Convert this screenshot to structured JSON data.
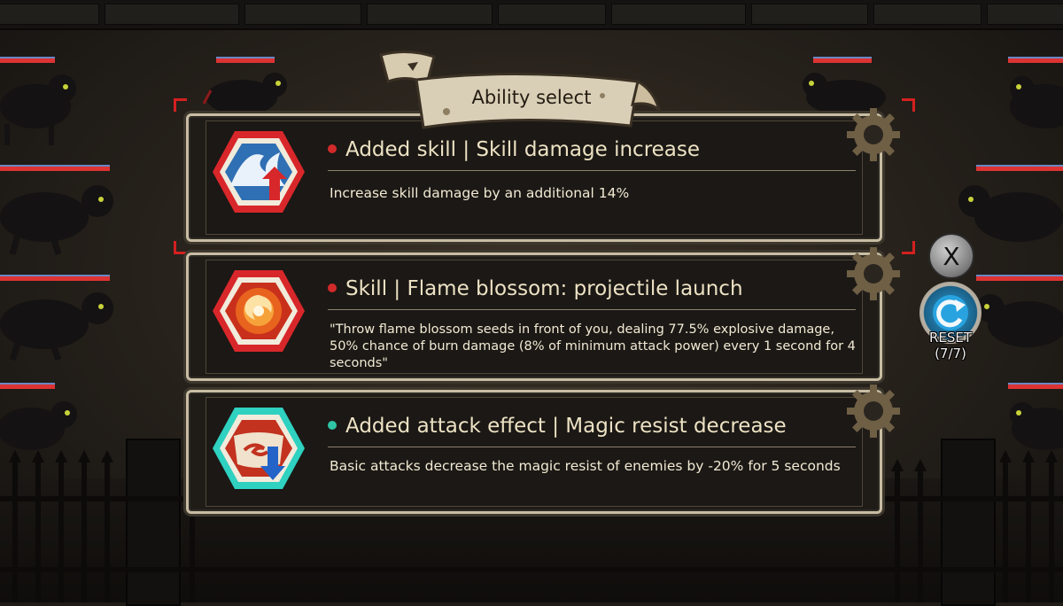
{
  "header": {
    "title": "Ability select"
  },
  "cards": [
    {
      "title": "Added skill | Skill damage increase",
      "description": "Increase skill damage by an additional 14%",
      "dot_color": "#d12a2a",
      "icon": "skill-damage-increase-icon",
      "hex_color": "#d8272a"
    },
    {
      "title": "Skill | Flame blossom: projectile launch",
      "description": "\"Throw flame blossom seeds in front of you, dealing 77.5% explosive damage, 50% chance of burn damage (8% of minimum attack power) every 1 second for 4 seconds\"",
      "dot_color": "#d12a2a",
      "icon": "flame-blossom-icon",
      "hex_color": "#d8272a"
    },
    {
      "title": "Added attack effect | Magic resist decrease",
      "description": "Basic attacks decrease the magic resist of enemies by -20% for 5 seconds",
      "dot_color": "#2fc4a5",
      "icon": "magic-resist-decrease-icon",
      "hex_color": "#2fd1c0"
    }
  ],
  "controls": {
    "close_label": "X",
    "reset_label": "RESET",
    "reset_count": "(7/7)"
  },
  "colors": {
    "frame": "#c8bda3",
    "card_bg": "#1f1c18",
    "title_text": "#ede2c4",
    "bracket": "#d42020"
  }
}
